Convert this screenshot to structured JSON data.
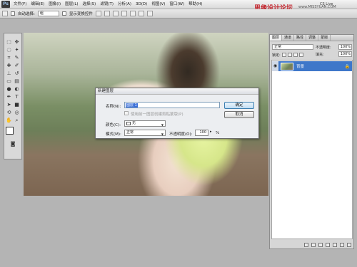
{
  "app": {
    "logo": "Ps"
  },
  "menu": {
    "items": [
      "文件(F)",
      "编辑(E)",
      "图像(I)",
      "图层(L)",
      "选择(S)",
      "滤镜(T)",
      "分析(A)",
      "3D(D)",
      "视图(V)",
      "窗口(W)",
      "帮助(H)"
    ]
  },
  "header": {
    "cs_live": "CS Live",
    "watermark": "思缘设计论坛",
    "watermark_url": "www.MISSYUAN.COM"
  },
  "options_bar": {
    "auto_select_label": "自动选择:",
    "auto_select_value": "组",
    "show_transform_label": "显示变换控件"
  },
  "dialog": {
    "title": "新建图层",
    "name_label": "名称(N):",
    "name_value": "图层 1",
    "clip_label": "使用前一图层创建剪贴蒙版(P)",
    "color_label": "颜色(C):",
    "color_value": "无",
    "mode_label": "模式(M):",
    "mode_value": "正常",
    "opacity_label": "不透明度(O):",
    "opacity_value": "100",
    "opacity_unit": "%",
    "ok_label": "确定",
    "cancel_label": "取消"
  },
  "layers_panel": {
    "tabs": [
      "图层",
      "通道",
      "路径",
      "调整",
      "蒙版"
    ],
    "blend_mode": "正常",
    "opacity_label": "不透明度:",
    "opacity_value": "100%",
    "lock_label": "锁定:",
    "fill_label": "填充:",
    "fill_value": "100%",
    "layer_name": "背景"
  },
  "colors": {
    "selection": "#3e77c9",
    "watermark": "#c3262e"
  }
}
